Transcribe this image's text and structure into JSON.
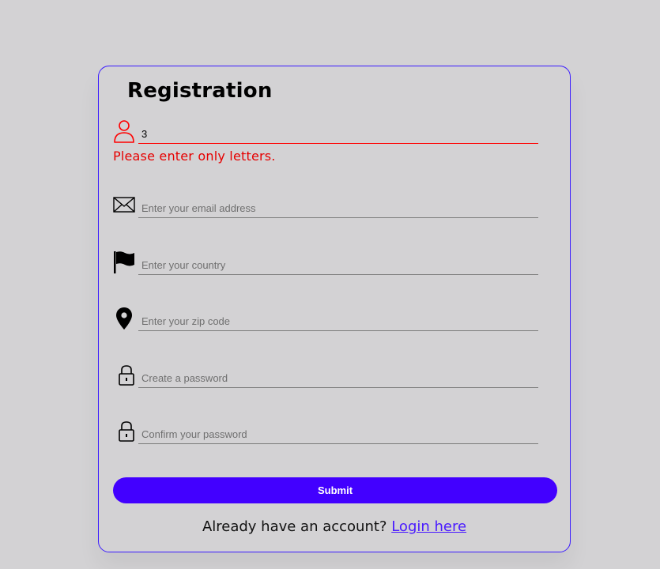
{
  "form": {
    "title": "Registration",
    "fields": [
      {
        "icon": "user-icon",
        "value": "3",
        "placeholder": ""
      },
      {
        "icon": "mail-icon",
        "value": "",
        "placeholder": "Enter your email address"
      },
      {
        "icon": "flag-icon",
        "value": "",
        "placeholder": "Enter your country"
      },
      {
        "icon": "location-pin-icon",
        "value": "",
        "placeholder": "Enter your zip code"
      },
      {
        "icon": "lock-icon",
        "value": "",
        "placeholder": "Create a password"
      },
      {
        "icon": "lock-icon",
        "value": "",
        "placeholder": "Confirm your password"
      }
    ],
    "error_message": "Please enter only letters.",
    "submit_label": "Submit",
    "login_prompt": "Already have an account?",
    "login_link": "Login here"
  },
  "colors": {
    "accent": "#4200ff",
    "error": "#ff0000",
    "background": "#d3d2d4"
  }
}
